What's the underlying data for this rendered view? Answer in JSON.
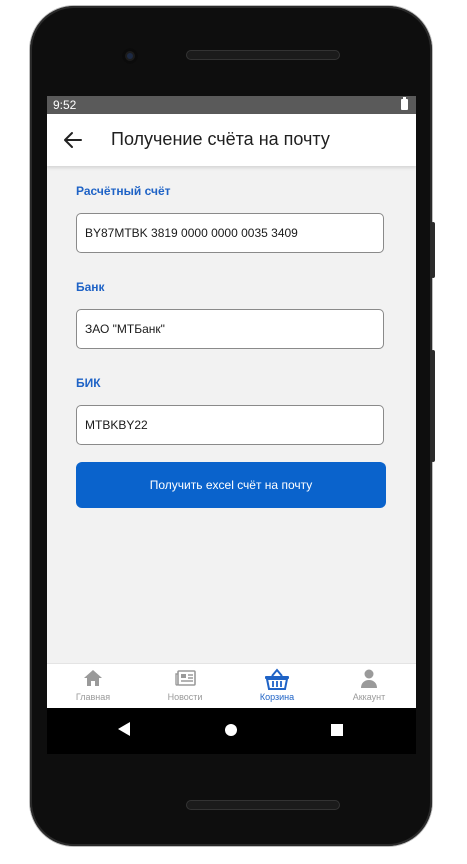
{
  "status_bar": {
    "time": "9:52"
  },
  "app_bar": {
    "title": "Получение счёта на почту"
  },
  "form": {
    "account_label": "Расчётный счёт",
    "account_value": "BY87MTBK 3819 0000 0000 0035 3409",
    "bank_label": "Банк",
    "bank_value": "ЗАО \"МТБанк\"",
    "bic_label": "БИК",
    "bic_value": "MTBKBY22",
    "submit_label": "Получить excel счёт на почту"
  },
  "bottom_nav": {
    "items": [
      {
        "label": "Главная",
        "icon": "home-icon",
        "active": false
      },
      {
        "label": "Новости",
        "icon": "newspaper-icon",
        "active": false
      },
      {
        "label": "Корзина",
        "icon": "basket-icon",
        "active": true
      },
      {
        "label": "Аккаунт",
        "icon": "account-icon",
        "active": false
      }
    ]
  },
  "colors": {
    "accent": "#1f63c6",
    "button": "#0a63cc",
    "screen_bg": "#f2f2f2",
    "inactive_icon": "#9a9a9a"
  }
}
